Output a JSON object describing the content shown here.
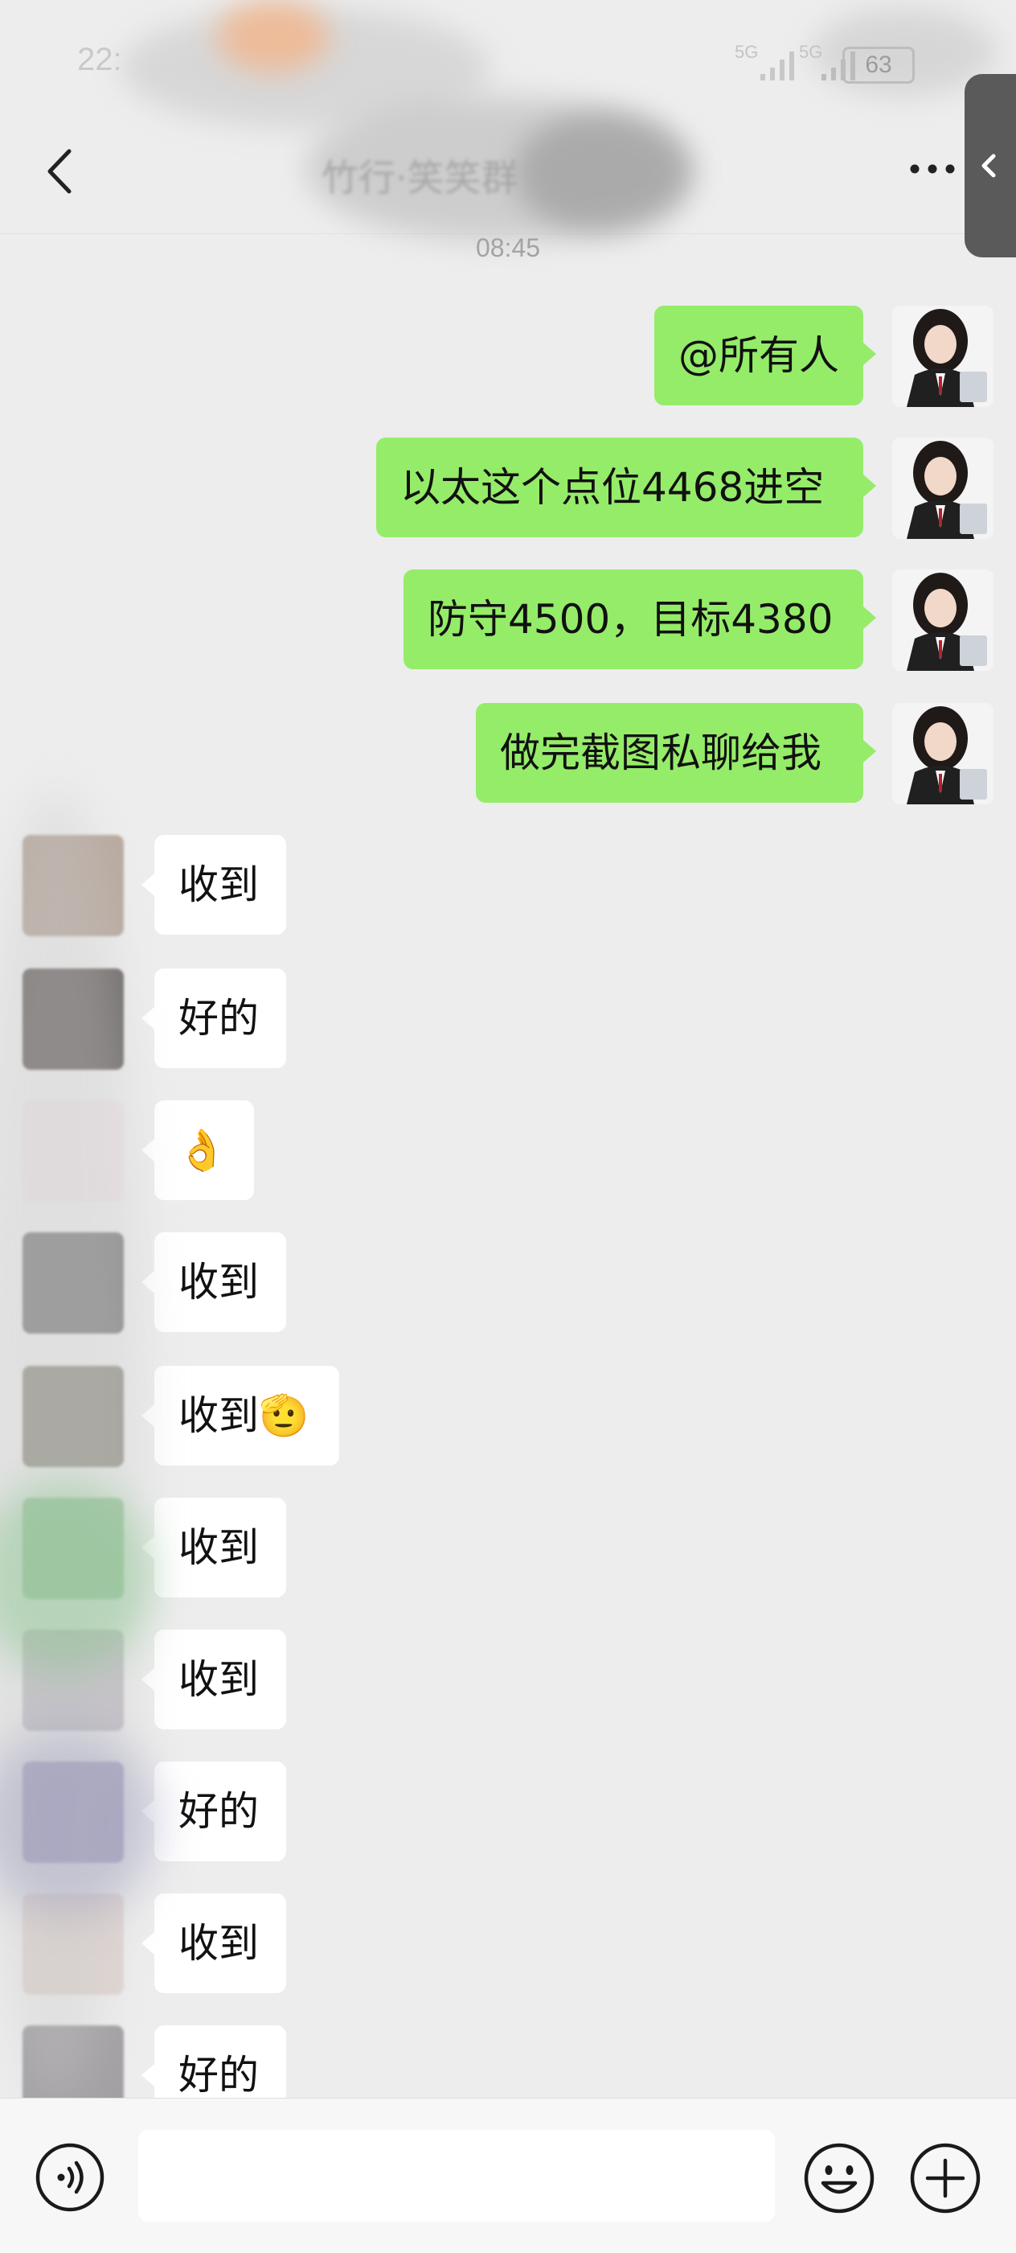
{
  "status_bar": {
    "time": "22:",
    "network_1": "5G",
    "network_2": "5G",
    "battery": "63"
  },
  "header": {
    "title": "竹行·笑笑群"
  },
  "timestamp": "08:45",
  "messages": [
    {
      "direction": "out",
      "text": "@所有人"
    },
    {
      "direction": "out",
      "text": "以太这个点位4468进空"
    },
    {
      "direction": "out",
      "text": "防守4500，目标4380"
    },
    {
      "direction": "out",
      "text": "做完截图私聊给我"
    },
    {
      "direction": "in",
      "text": "收到"
    },
    {
      "direction": "in",
      "text": "好的"
    },
    {
      "direction": "in",
      "text": "👌"
    },
    {
      "direction": "in",
      "text": "收到"
    },
    {
      "direction": "in",
      "text": "收到🫡"
    },
    {
      "direction": "in",
      "text": "收到"
    },
    {
      "direction": "in",
      "text": "收到"
    },
    {
      "direction": "in",
      "text": "好的"
    },
    {
      "direction": "in",
      "text": "收到"
    },
    {
      "direction": "in",
      "text": "好的"
    }
  ],
  "input_bar": {
    "voice_icon": "voice-icon",
    "emoji_icon": "emoji-icon",
    "plus_icon": "plus-icon"
  },
  "colors": {
    "background": "#ededed",
    "outgoing_bubble": "#95ec69",
    "incoming_bubble": "#ffffff",
    "timestamp": "#a3a3a3"
  }
}
